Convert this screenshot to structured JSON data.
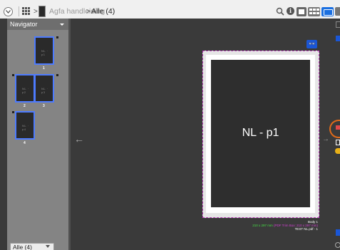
{
  "toolbar": {
    "breadcrumb_separator": ">",
    "document_name": "Agfa handleiding",
    "current_view": "Alle (4)",
    "info_label": "i",
    "icons": {
      "back": "circle-chevron-down-icon",
      "grid": "grid-icon",
      "search": "search-icon",
      "info": "info-icon",
      "single_page": "single-page-view-icon",
      "thumbnails": "thumbnail-view-icon",
      "spread": "spread-view-icon",
      "settings": "gear-icon"
    },
    "accent_color": "#1a6fe0"
  },
  "navigator": {
    "title": "Navigator",
    "pages": [
      {
        "label": "1",
        "selected": true
      },
      {
        "label": "2",
        "selected": true
      },
      {
        "label": "3",
        "selected": true
      },
      {
        "label": "4",
        "selected": true
      }
    ],
    "filter_select": {
      "value": "Alle (4)"
    }
  },
  "viewer": {
    "prev_arrow": "←",
    "next_arrow": "→",
    "glasses_label": "👓",
    "page_content": "NL - p1",
    "info": {
      "line1": "Body 1",
      "line2_green": "210 x 297 mm",
      "line2_magenta": "(PDF Trim Box: 210 x 297 mm)",
      "line3": "TEST NL.pdf - 1"
    },
    "colors": {
      "selection_border": "#4d7bff",
      "trim_box": "#c040c0",
      "size_text": "#46e046"
    }
  }
}
